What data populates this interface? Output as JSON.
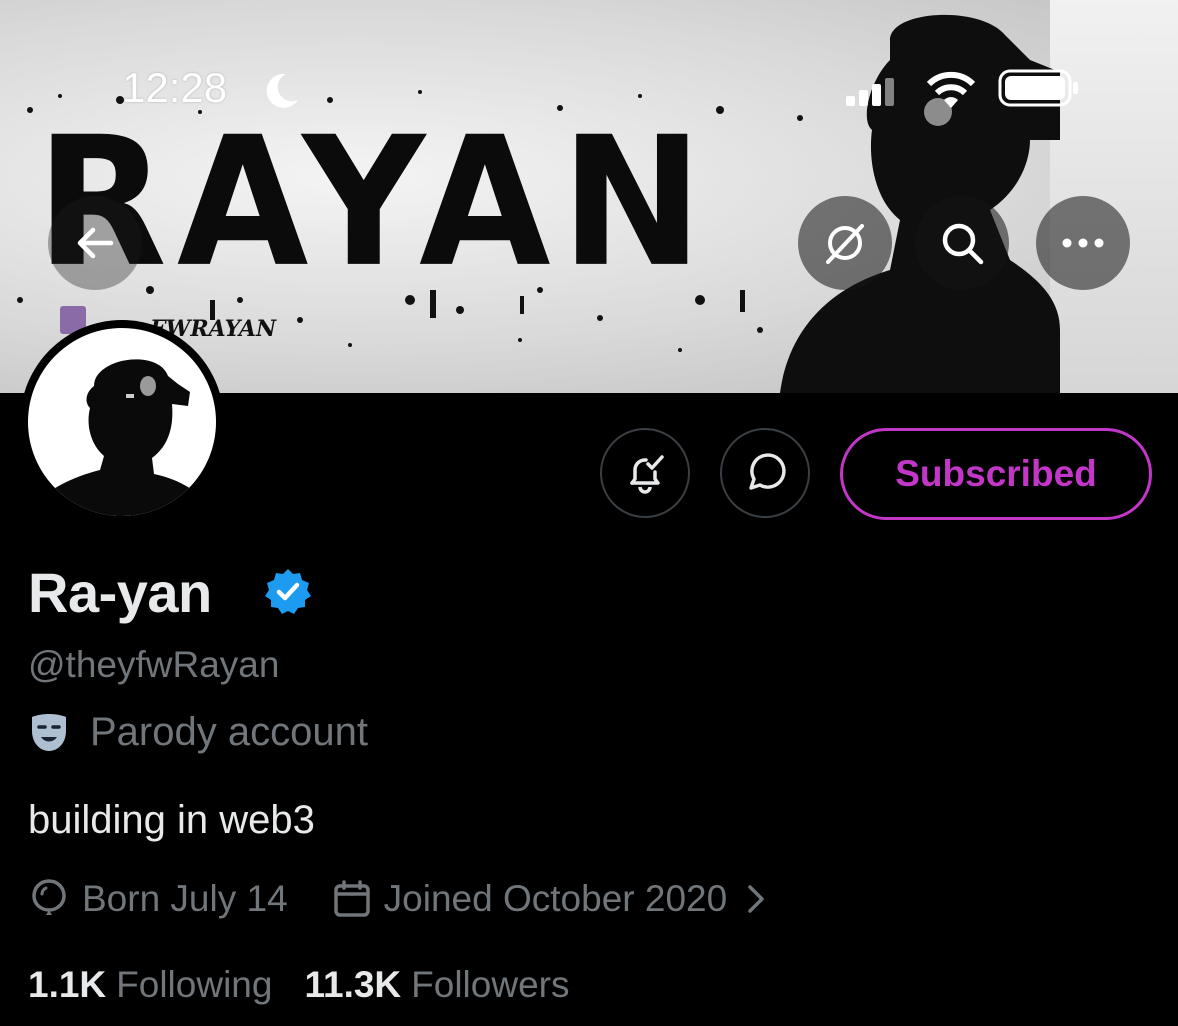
{
  "status_bar": {
    "time": "12:28",
    "icons": [
      "moon-icon",
      "signal-icon",
      "wifi-icon",
      "battery-icon"
    ]
  },
  "banner": {
    "wordmark": "RAYAN",
    "sub_text": "FWRAYAN",
    "buttons": [
      "back-arrow-icon",
      "grok-icon",
      "search-icon",
      "more-icon"
    ]
  },
  "actions": {
    "notify_icon": "bell-check-icon",
    "message_icon": "message-bubble-icon",
    "subscribed_label": "Subscribed"
  },
  "profile": {
    "display_name": "Ra-yan",
    "verified_icon": "verified-badge-icon",
    "handle": "@theyfwRayan",
    "parody_label": "Parody account",
    "bio": "building in web3",
    "born": "Born July 14",
    "joined": "Joined October 2020",
    "following_count": "1.1K",
    "following_label": "Following",
    "followers_count": "11.3K",
    "followers_label": "Followers"
  },
  "colors": {
    "background": "#000000",
    "text_primary": "#e7e9ea",
    "text_secondary": "#71767b",
    "subscribed_accent": "#c237c8",
    "verified_blue": "#1d9bf0",
    "border": "#3a3f44"
  }
}
